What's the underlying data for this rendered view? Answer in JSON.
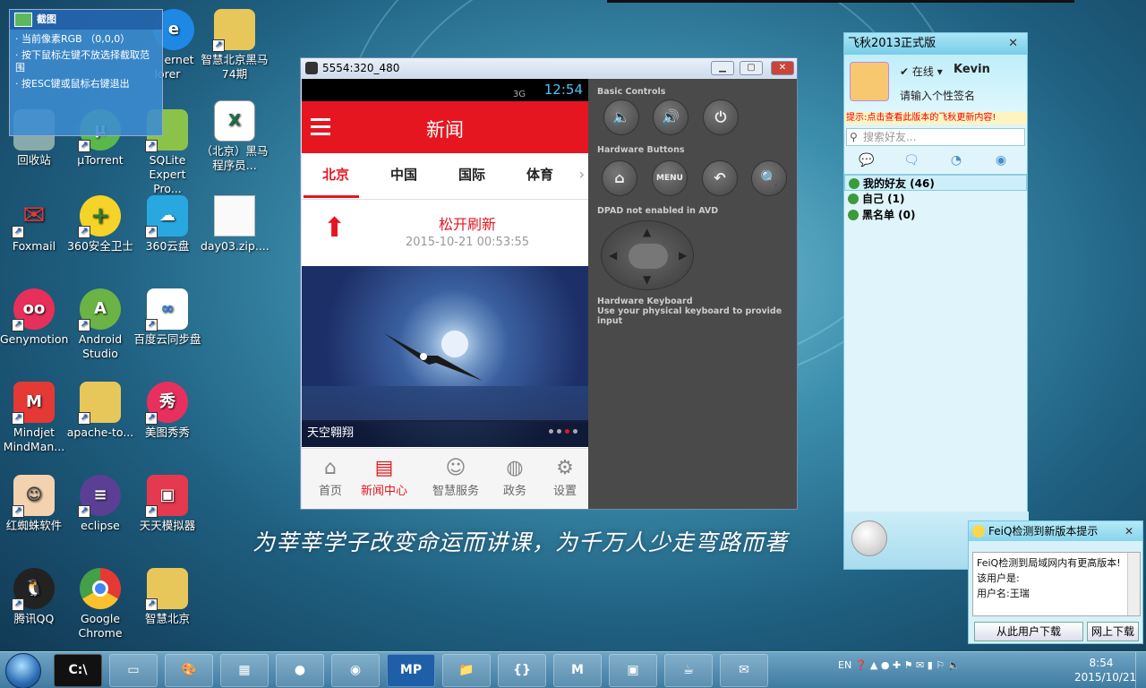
{
  "desktop_icons": [
    {
      "label": "回收站"
    },
    {
      "label": "µTorrent"
    },
    {
      "label": "SQLite Expert Pro..."
    },
    {
      "label": "（北京）黑马程序员..."
    },
    {
      "label": "Foxmail"
    },
    {
      "label": "360安全卫士"
    },
    {
      "label": "360云盘"
    },
    {
      "label": "day03.zip...."
    },
    {
      "label": "Genymotion"
    },
    {
      "label": "Android Studio"
    },
    {
      "label": "百度云同步盘"
    },
    {
      "label": "Mindjet MindMan..."
    },
    {
      "label": "apache-to..."
    },
    {
      "label": "美图秀秀"
    },
    {
      "label": "红蜘蛛软件"
    },
    {
      "label": "eclipse"
    },
    {
      "label": "天天模拟器"
    },
    {
      "label": "腾讯QQ"
    },
    {
      "label": "Google Chrome"
    },
    {
      "label": "智慧北京"
    },
    {
      "label": "ernet lorer"
    },
    {
      "label": "智慧北京黑马74期"
    }
  ],
  "snip_tool": {
    "title": "截图",
    "line1": "· 当前像素RGB （0,0,0）",
    "line2": "· 按下鼠标左键不放选择截取范围",
    "line3": "· 按ESC键或鼠标右键退出"
  },
  "emulator": {
    "title": "5554:320_480",
    "status_time": "12:54",
    "status_signal": "3G",
    "app_title": "新闻",
    "tabs": [
      "北京",
      "中国",
      "国际",
      "体育"
    ],
    "refresh_msg": "松开刷新",
    "refresh_date": "2015-10-21 00:53:55",
    "banner_caption": "天空翱翔",
    "bottom_nav": [
      "首页",
      "新闻中心",
      "智慧服务",
      "政务",
      "设置"
    ],
    "controls": {
      "basic_label": "Basic Controls",
      "hardware_label": "Hardware Buttons",
      "menu_label": "MENU",
      "dpad_label": "DPAD not enabled in AVD",
      "keyboard_title": "Hardware Keyboard",
      "keyboard_desc": "Use your physical keyboard to provide input"
    }
  },
  "feiq": {
    "title": "飞秋2013正式版",
    "status": "在线",
    "username": "Kevin",
    "signature": "请输入个性签名",
    "notice": "提示:点击查看此版本的飞秋更新内容!",
    "search_placeholder": "搜索好友...",
    "groups": [
      "我的好友 (46)",
      "自己 (1)",
      "黑名单 (0)"
    ]
  },
  "feiq_popup": {
    "title": "FeiQ检测到新版本提示",
    "body1": "FeiQ检测到局域网内有更高版本!该用户是:",
    "body2": "用户名:王瑞",
    "btn_user": "从此用户下载",
    "btn_web": "网上下载"
  },
  "slogan": "为莘莘学子改变命运而讲课，为千万人少走弯路而著",
  "taskbar": {
    "lang": "EN",
    "time": "8:54",
    "date": "2015/10/21",
    "mp_label": "MP"
  }
}
